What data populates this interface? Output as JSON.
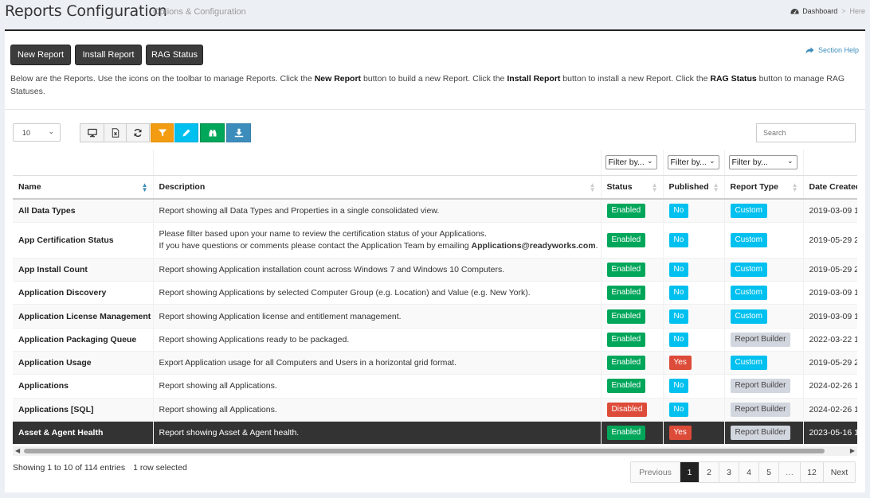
{
  "header": {
    "title": "Reports Configuration",
    "subtitle": "Options & Configuration",
    "breadcrumb": {
      "dashboard": "Dashboard",
      "separator": ">",
      "current": "Here"
    }
  },
  "toolbar": {
    "new_report": "New Report",
    "install_report": "Install Report",
    "rag_status": "RAG Status",
    "section_help": "Section Help"
  },
  "intro": {
    "p1": "Below are the Reports. Use the icons on the toolbar to manage Reports. Click the ",
    "b1": "New Report",
    "p2": " button to build a new Report. Click the ",
    "b2": "Install Report",
    "p3": " button to install a new Report. Click the ",
    "b3": "RAG Status",
    "p4": " button to manage RAG Statuses."
  },
  "table_controls": {
    "page_length": "10",
    "search_placeholder": "Search",
    "tool_icons": [
      "monitor-icon",
      "excel-file-icon",
      "refresh-icon",
      "filter-icon",
      "pencil-icon",
      "binoculars-icon",
      "download-icon"
    ]
  },
  "table": {
    "filter_placeholder": "Filter by...",
    "columns": [
      "Name",
      "Description",
      "Status",
      "Published",
      "Report Type",
      "Date Created"
    ],
    "rows": [
      {
        "name": "All Data Types",
        "desc": "Report showing all Data Types and Properties in a single consolidated view.",
        "status": "Enabled",
        "published": "No",
        "type": "Custom",
        "date": "2019-03-09 1"
      },
      {
        "name": "App Certification Status",
        "desc_line1": "Please filter based upon your name to review the certification status of your Applications.",
        "desc_line2": "If you have questions or comments please contact the Application Team by emailing ",
        "desc_email": "Applications@readyworks.com",
        "desc_end": ".",
        "status": "Enabled",
        "published": "No",
        "type": "Custom",
        "date": "2019-05-29 2"
      },
      {
        "name": "App Install Count",
        "desc": "Report showing Application installation count across Windows 7 and Windows 10 Computers.",
        "status": "Enabled",
        "published": "No",
        "type": "Custom",
        "date": "2019-05-29 2"
      },
      {
        "name": "Application Discovery",
        "desc": "Report showing Applications by selected Computer Group (e.g. Location) and Value (e.g. New York).",
        "status": "Enabled",
        "published": "No",
        "type": "Custom",
        "date": "2019-03-09 1"
      },
      {
        "name": "Application License Management",
        "desc": "Report showing Application license and entitlement management.",
        "status": "Enabled",
        "published": "No",
        "type": "Custom",
        "date": "2019-03-09 1"
      },
      {
        "name": "Application Packaging Queue",
        "desc": "Report showing Applications ready to be packaged.",
        "status": "Enabled",
        "published": "No",
        "type": "Report Builder",
        "date": "2022-03-22 1"
      },
      {
        "name": "Application Usage",
        "desc": "Export Application usage for all Computers and Users in a horizontal grid format.",
        "status": "Enabled",
        "published": "Yes",
        "type": "Custom",
        "date": "2019-05-29 2"
      },
      {
        "name": "Applications",
        "desc": "Report showing all Applications.",
        "status": "Enabled",
        "published": "No",
        "type": "Report Builder",
        "date": "2024-02-26 1"
      },
      {
        "name": "Applications [SQL]",
        "desc": "Report showing all Applications.",
        "status": "Disabled",
        "published": "No",
        "type": "Report Builder",
        "date": "2024-02-26 1"
      },
      {
        "name": "Asset & Agent Health",
        "desc": "Report showing Asset & Agent health.",
        "status": "Enabled",
        "published": "Yes",
        "type": "Report Builder",
        "date": "2023-05-16 1"
      }
    ]
  },
  "footer": {
    "info": "Showing 1 to 10 of 114 entries",
    "selected": "1 row selected",
    "pagination": [
      "Previous",
      "1",
      "2",
      "3",
      "4",
      "5",
      "…",
      "12",
      "Next"
    ]
  }
}
